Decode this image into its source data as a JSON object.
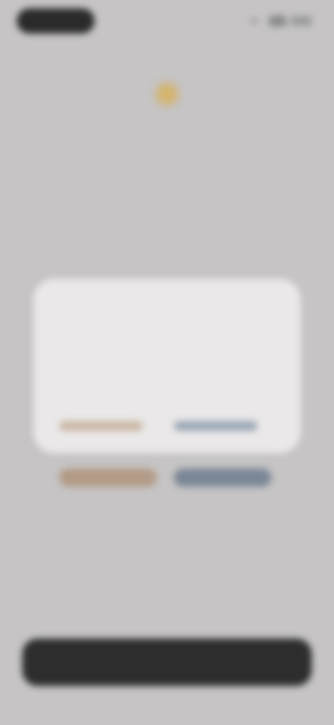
{
  "status_bar": {
    "signal_icon": "signal-icon",
    "wifi_icon": "wifi-icon",
    "battery_icon": "battery-icon"
  },
  "hero": {
    "icon": "lightbulb-icon",
    "accent": "#d2b36b",
    "title": "",
    "subtitle": ""
  },
  "card": {
    "title": "",
    "body": ""
  },
  "options": [
    {
      "label": "",
      "accent": "#b29a86"
    },
    {
      "label": "",
      "accent": "#7a8696"
    }
  ],
  "link_text": "",
  "primary_button": {
    "label": "",
    "color": "#2d2d2d"
  }
}
